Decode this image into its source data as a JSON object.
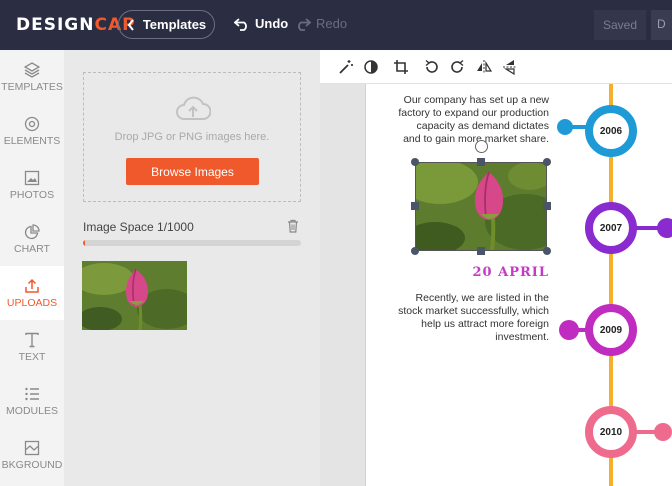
{
  "app": {
    "logo_design": "DESIGN",
    "logo_cap": "CAP",
    "templates_label": "Templates",
    "undo_label": "Undo",
    "redo_label": "Redo",
    "saved_label": "Saved",
    "download_label": "D",
    "accent_color": "#f0592b"
  },
  "sidebar": {
    "items": [
      {
        "label": "TEMPLATES",
        "icon": "layers-icon"
      },
      {
        "label": "ELEMENTS",
        "icon": "elements-icon"
      },
      {
        "label": "PHOTOS",
        "icon": "photo-icon"
      },
      {
        "label": "CHART",
        "icon": "pie-chart-icon"
      },
      {
        "label": "UPLOADS",
        "icon": "upload-icon",
        "active": true
      },
      {
        "label": "TEXT",
        "icon": "text-icon"
      },
      {
        "label": "MODULES",
        "icon": "list-icon"
      },
      {
        "label": "BKGROUND",
        "icon": "background-icon"
      }
    ]
  },
  "uploads": {
    "drop_hint": "Drop JPG or PNG images here.",
    "browse_label": "Browse Images",
    "space_label": "Image Space 1/1000",
    "space_used_fraction": 0.001
  },
  "toolbar": {
    "tools": [
      "magic-wand-icon",
      "contrast-icon",
      "crop-icon",
      "rotate-left-icon",
      "rotate-right-icon",
      "flip-horizontal-icon",
      "flip-vertical-icon"
    ]
  },
  "canvas": {
    "paragraph_1": "Our company has set up a new factory to expand our production capacity as demand dictates and to gain more market share.",
    "date_label": "20 APRIL",
    "paragraph_2": "Recently, we are listed in the stock market successfully, which help us attract more foreign investment.",
    "timeline": [
      {
        "year": "2006",
        "color": "#1e9bd7"
      },
      {
        "year": "2007",
        "color": "#8a2bd0"
      },
      {
        "year": "2009",
        "color": "#c02cbf"
      },
      {
        "year": "2010",
        "color": "#ef6b8e"
      }
    ]
  }
}
